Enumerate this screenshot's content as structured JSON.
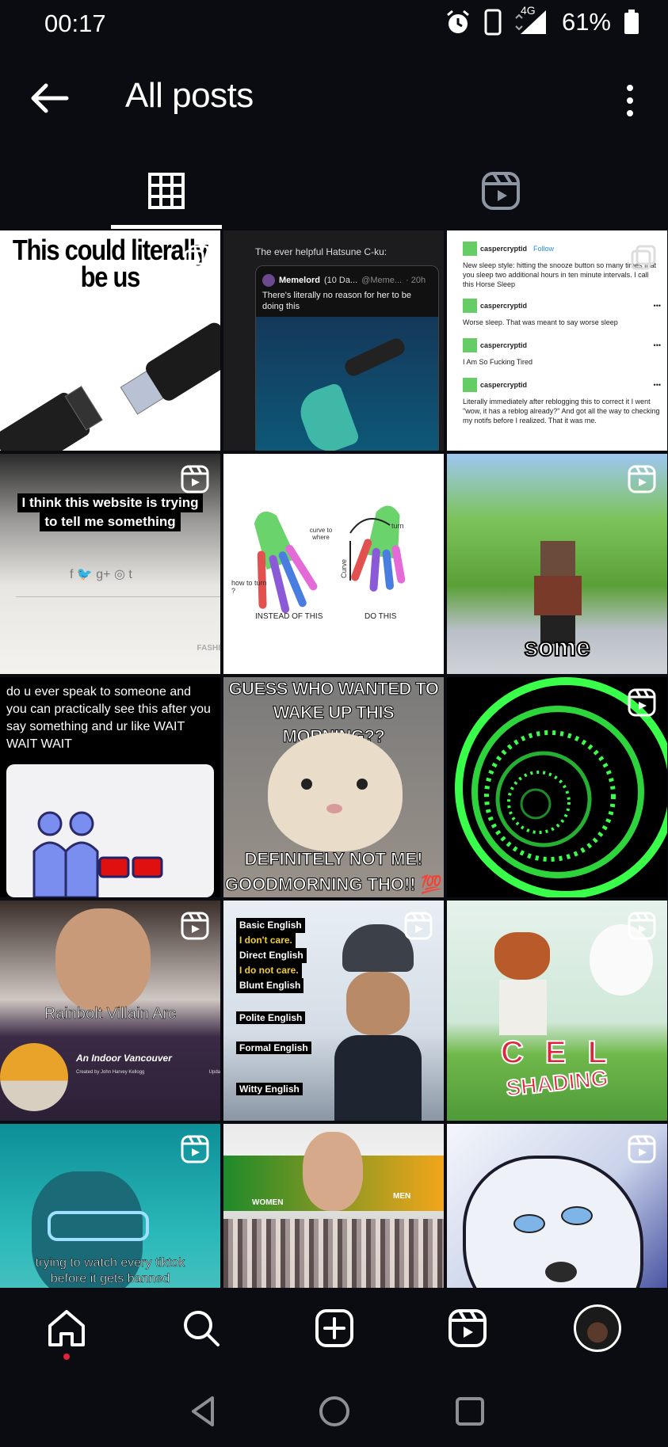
{
  "status": {
    "time": "00:17",
    "network": "4G",
    "battery": "61%"
  },
  "appbar": {
    "title": "All posts"
  },
  "posts": {
    "p1": {
      "line1": "This could literally",
      "line2": "be us"
    },
    "p2": {
      "intro": "The ever helpful Hatsune C-ku:",
      "author": "Memelord",
      "author_suffix": "(10 Da...",
      "handle": "@Meme...",
      "time": "· 20h",
      "body": "There's literally no reason for her to be doing this"
    },
    "p3": {
      "user": "caspercryptid",
      "follow": "Follow",
      "t1": "New sleep style: hitting the snooze button so many times that you sleep two additional hours in ten minute intervals. I call this Horse Sleep",
      "t2": "Worse sleep. That was meant to say worse sleep",
      "t3": "I Am So Fucking Tired",
      "t4": "Literally immediately after reblogging this to correct it I went \"wow, it has a reblog already?\" And got all the way to checking my notifs before I realized. That it was me."
    },
    "p4": {
      "line1": "I think this website is trying",
      "line2": "to tell me something",
      "icons": "f 🐦 g+ ◎ t",
      "watermark": "FASHI"
    },
    "p5": {
      "left1": "curve to where",
      "left2": "how to turn ?",
      "left3": "INSTEAD OF THIS",
      "right1": "turn",
      "right2": "Curve",
      "right3": "DO THIS"
    },
    "p6": {
      "caption": "some"
    },
    "p7": {
      "text": "do u ever speak to someone and you can practically see this after you say something and ur like WAIT WAIT WAIT"
    },
    "p8": {
      "top": "GUESS WHO WANTED TO WAKE UP THIS MORNING??",
      "bottom1": "DEFINITELY NOT ME!",
      "bottom2": "GOODMORNING THO!! 💯"
    },
    "p10": {
      "caption": "Rainbolt Villain Arc",
      "game": "An Indoor Vancouver",
      "credit": "Created by John Harvey Kellogg",
      "update": "Upda"
    },
    "p11": {
      "lines": [
        "Basic English",
        "I don't care.",
        "Direct English",
        "I do not care.",
        "Blunt English",
        "Polite English",
        "Formal English",
        "Witty English"
      ]
    },
    "p12": {
      "line1": "C E L",
      "line2": "SHADING"
    },
    "p13": {
      "line1": "trying to watch every tiktok",
      "line2": "before it gets banned"
    },
    "p14": {
      "left": "WOMEN",
      "right": "MEN"
    }
  },
  "colors": {
    "bg": "#0b0c12",
    "accent_red": "#e0223a",
    "green": "#39ff4a"
  }
}
